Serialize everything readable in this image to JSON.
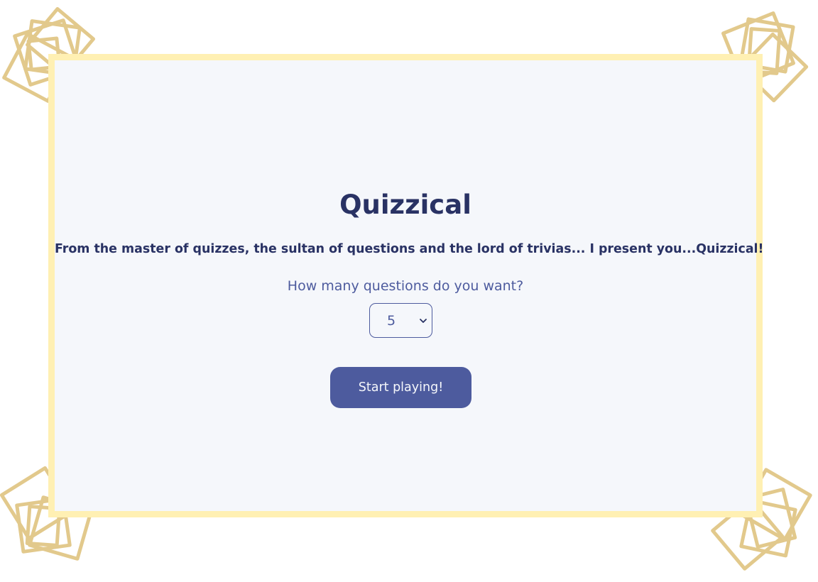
{
  "app": {
    "title": "Quizzical",
    "tagline_main": "From the master of quizzes, the sultan of questions and the lord of trivias... I present you...",
    "tagline_brand": "Quizzical!",
    "question_prompt": "How many questions do you want?"
  },
  "question_count_select": {
    "selected_value": "5",
    "icon": "chevron-down-icon"
  },
  "start_button": {
    "label": "Start playing!"
  },
  "colors": {
    "title": "#293264",
    "accent": "#4d5b9e",
    "card_background": "#f5f7fb",
    "card_border": "#fff0b3",
    "decoration": "#e2c98c"
  },
  "decorations": {
    "icon": "stacked-cards-icon"
  }
}
